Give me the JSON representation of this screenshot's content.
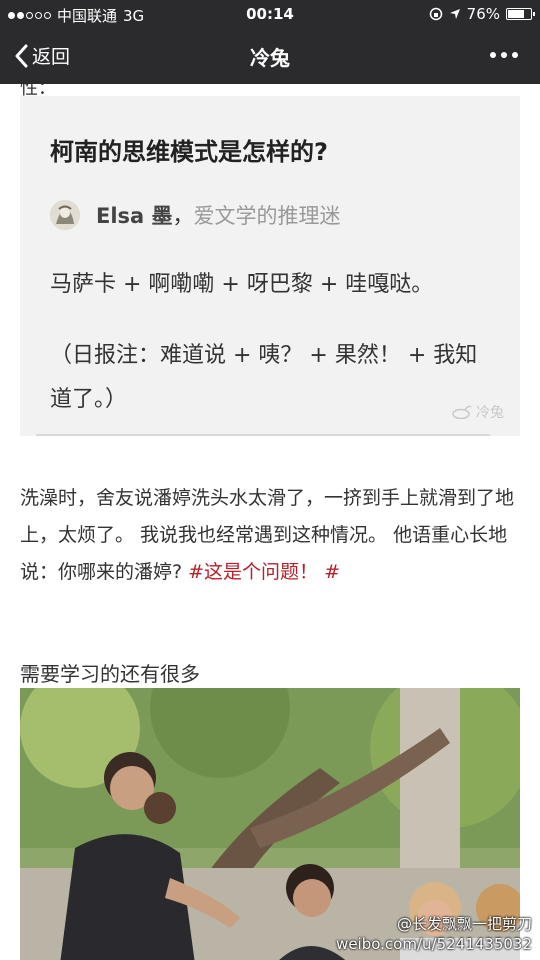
{
  "status_bar": {
    "carrier": "中国联通",
    "network": "3G",
    "time": "00:14",
    "battery": "76%",
    "battery_level": 0.76,
    "signal_bars_filled": 2,
    "signal_bars_total": 5
  },
  "nav": {
    "back_label": "返回",
    "title": "冷兔"
  },
  "content": {
    "cut_off_text": "性：",
    "card": {
      "question": "柯南的思维模式是怎样的?",
      "author_name": "Elsa 墨",
      "author_sep": "，",
      "author_bio": "爱文学的推理迷",
      "answer_line1": "马萨卡 + 啊嘞嘞 + 呀巴黎 + 哇嘎哒。",
      "answer_line2": "（日报注：难道说 + 咦？ + 果然！ + 我知道了。）",
      "watermark": "冷兔"
    },
    "paragraph_text": "洗澡时，舍友说潘婷洗头水太滑了，一挤到手上就滑到了地上，太烦了。 我说我也经常遇到这种情况。 他语重心长地说：你哪来的潘婷? ",
    "paragraph_tag": "#这是个问题！ #",
    "subheading": "需要学习的还有很多"
  },
  "watermark": {
    "line1": "@长发飘飘一把剪刀",
    "line2": "weibo.com/u/5241435032"
  },
  "colors": {
    "bar_bg": "#2b2b2e",
    "tag_red": "#b5202a",
    "card_bg": "#f2f2f2"
  },
  "icons": [
    "back-chevron-icon",
    "more-dots-icon",
    "location-arrow-icon",
    "lock-rotation-icon",
    "battery-icon"
  ]
}
